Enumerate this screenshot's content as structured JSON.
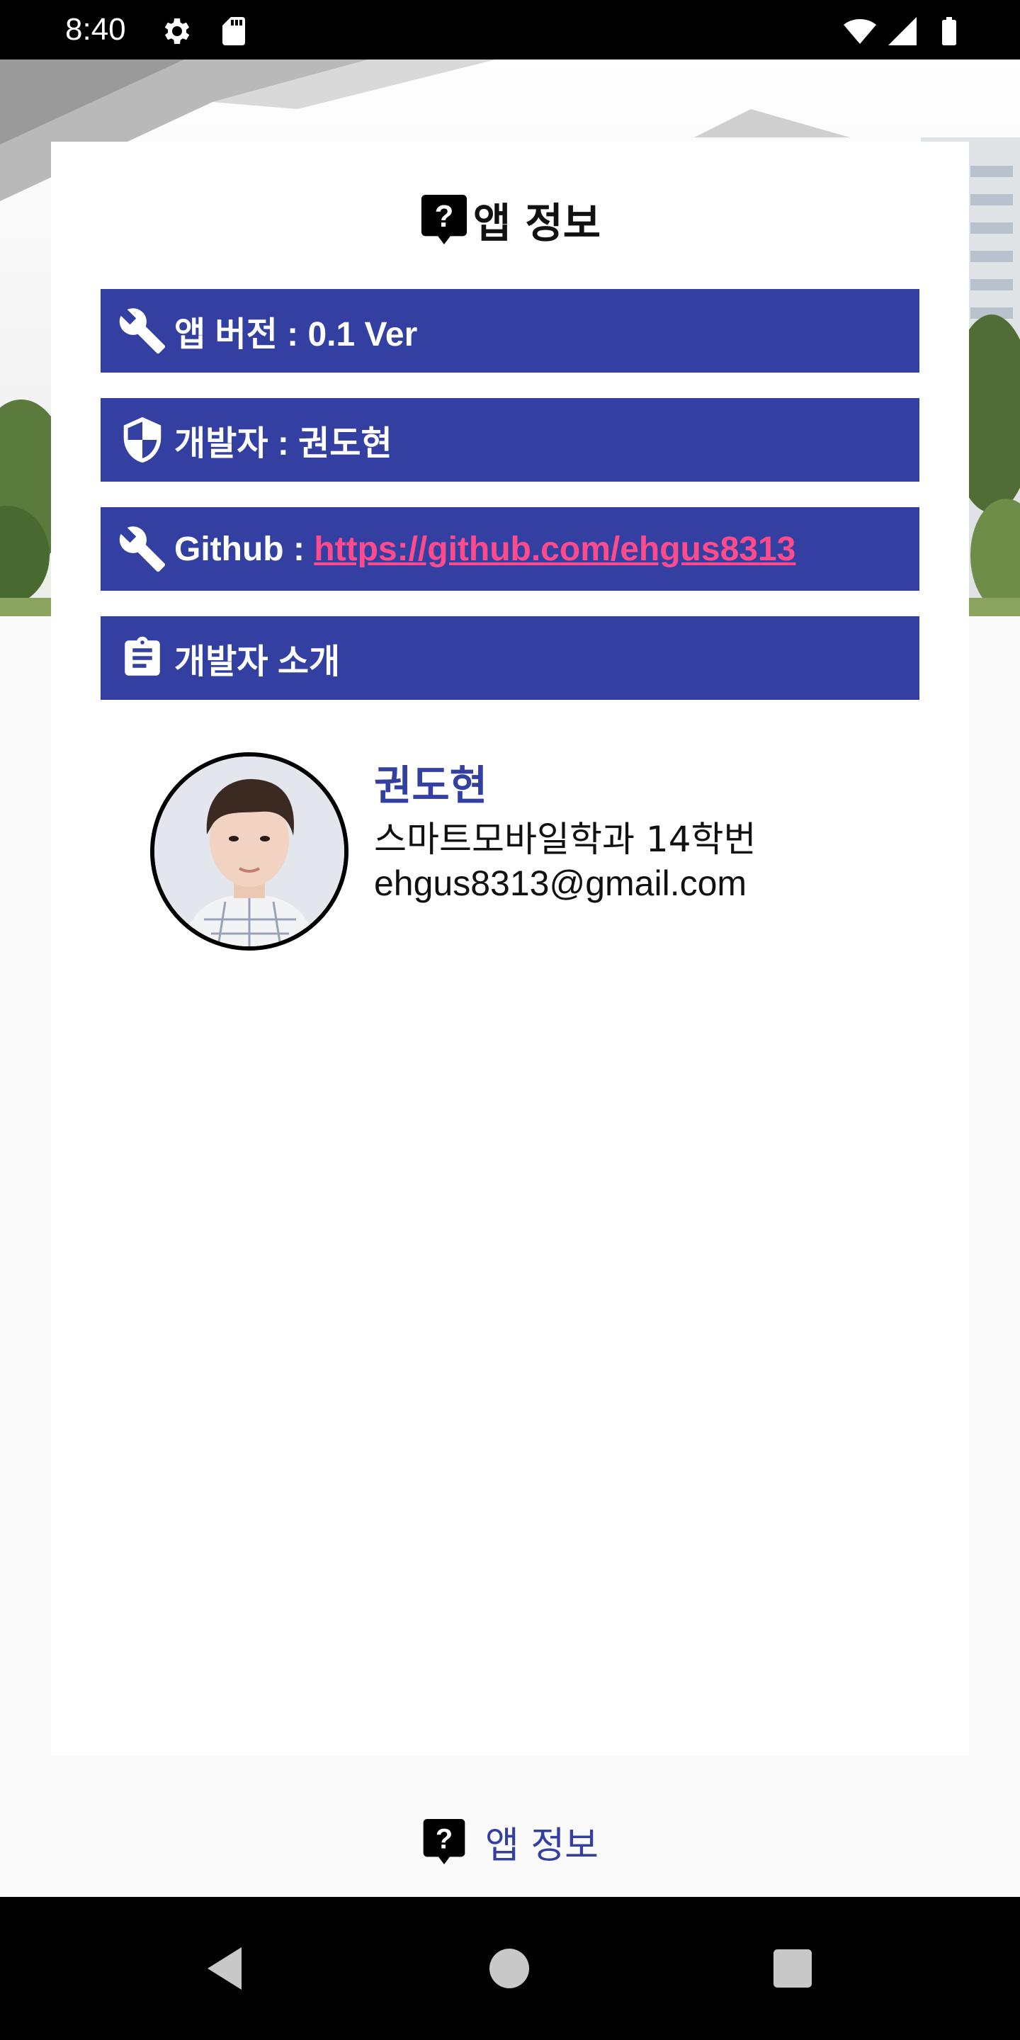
{
  "status_bar": {
    "time": "8:40",
    "icons": [
      "gear-icon",
      "sd-card-icon",
      "wifi-icon",
      "signal-icon",
      "battery-icon"
    ]
  },
  "card": {
    "title": "앱 정보",
    "title_icon": "question-bubble-icon"
  },
  "info_rows": [
    {
      "icon": "wrench-icon",
      "text": "앱 버전 : 0.1 Ver"
    },
    {
      "icon": "shield-icon",
      "text": "개발자 : 권도현"
    },
    {
      "icon": "wrench-icon",
      "label": "Github : ",
      "link": "https://github.com/ehgus8313"
    },
    {
      "icon": "clipboard-icon",
      "text": "개발자 소개"
    }
  ],
  "profile": {
    "name": "권도현",
    "department": "스마트모바일학과 14학번",
    "email": "ehgus8313@gmail.com"
  },
  "bottom_tab": {
    "label": "앱 정보",
    "icon": "question-bubble-icon"
  },
  "nav_bar": {
    "buttons": [
      "back-icon",
      "home-icon",
      "recents-icon"
    ]
  },
  "colors": {
    "accent": "#3340a2",
    "link": "#ff4b8c",
    "status_bar": "#000000",
    "background": "#fafafa"
  }
}
